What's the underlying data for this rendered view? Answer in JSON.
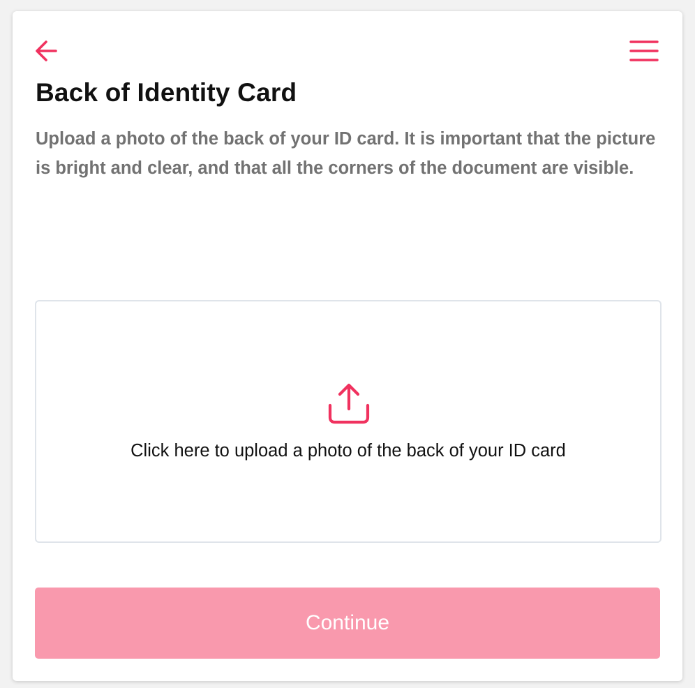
{
  "header": {
    "back_icon": "arrow-left-icon",
    "menu_icon": "hamburger-menu-icon",
    "accent_color": "#f0325f"
  },
  "page": {
    "title": "Back of Identity Card",
    "description": "Upload a photo of the back of your ID card. It is important that the picture is bright and clear, and that all the corners of the document are visible."
  },
  "upload": {
    "icon": "upload-icon",
    "label": "Click here to upload a photo of the back of your ID card"
  },
  "actions": {
    "continue_label": "Continue",
    "continue_color": "#f999ad"
  }
}
